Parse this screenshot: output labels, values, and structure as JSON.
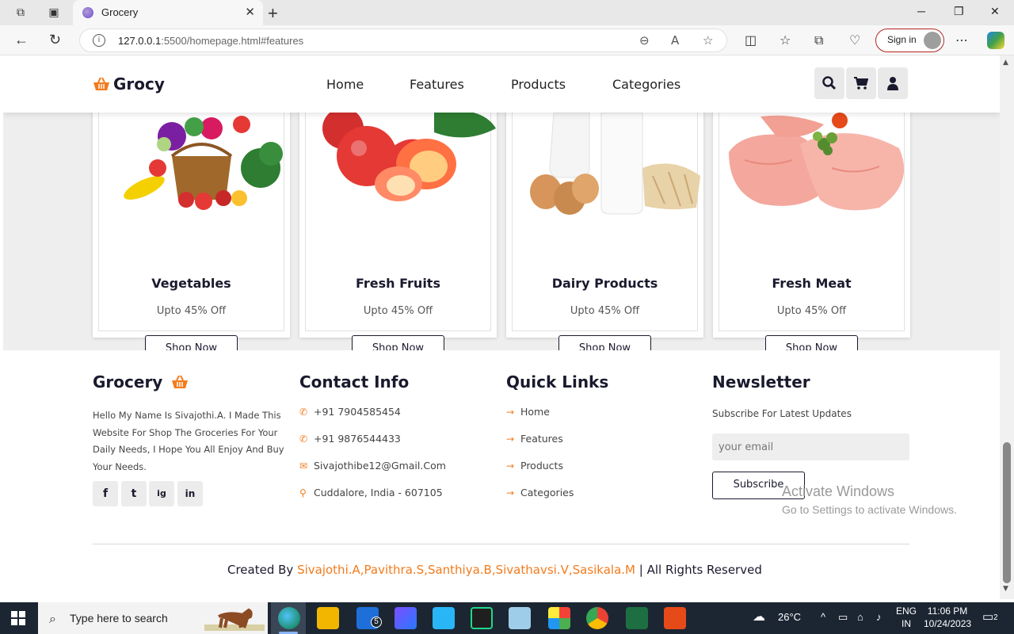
{
  "browser": {
    "tab_title": "Grocery",
    "url_host": "127.0.0.1",
    "url_rest": ":5500/homepage.html#features",
    "signin_label": "Sign in",
    "win_minimize": "─",
    "win_restore": "❐",
    "win_close": "✕",
    "new_tab": "+",
    "tab_close": "✕"
  },
  "header": {
    "logo": "Grocy",
    "nav": [
      "Home",
      "Features",
      "Products",
      "Categories"
    ],
    "icons": [
      "search-icon",
      "cart-icon",
      "user-icon"
    ]
  },
  "products": [
    {
      "title": "Vegetables",
      "offer": "Upto 45% Off",
      "button": "Shop Now"
    },
    {
      "title": "Fresh Fruits",
      "offer": "Upto 45% Off",
      "button": "Shop Now"
    },
    {
      "title": "Dairy Products",
      "offer": "Upto 45% Off",
      "button": "Shop Now"
    },
    {
      "title": "Fresh Meat",
      "offer": "Upto 45% Off",
      "button": "Shop Now"
    }
  ],
  "footer": {
    "about_title": "Grocery",
    "about_text": "Hello My Name Is Sivajothi.A. I Made This Website For Shop The Groceries For Your Daily Needs, I Hope You All Enjoy And Buy Your Needs.",
    "socials": [
      "f",
      "t",
      "ig",
      "in"
    ],
    "contact_title": "Contact Info",
    "contacts": [
      "+91 7904585454",
      "+91 9876544433",
      "Sivajothibe12@Gmail.Com",
      "Cuddalore, India - 607105"
    ],
    "links_title": "Quick Links",
    "links": [
      "Home",
      "Features",
      "Products",
      "Categories"
    ],
    "newsletter_title": "Newsletter",
    "newsletter_sub": "Subscribe For Latest Updates",
    "email_placeholder": "your email",
    "subscribe": "Subscribe",
    "credits_prefix": "Created By ",
    "credits_names": "Sivajothi.A,Pavithra.S,Santhiya.B,Sivathavsi.V,Sasikala.M",
    "credits_suffix": " | All Rights Reserved"
  },
  "watermark": {
    "line1": "Activate Windows",
    "line2": "Go to Settings to activate Windows."
  },
  "taskbar": {
    "search_placeholder": "Type here to search",
    "mail_badge": "5",
    "weather": "26°C",
    "lang_line1": "ENG",
    "lang_line2": "IN",
    "time": "11:06 PM",
    "date": "10/24/2023",
    "notif_count": "2"
  },
  "colors": {
    "accent": "#f37b1d",
    "dark_text": "#1a1a2e",
    "taskbar": "#1c2633"
  }
}
